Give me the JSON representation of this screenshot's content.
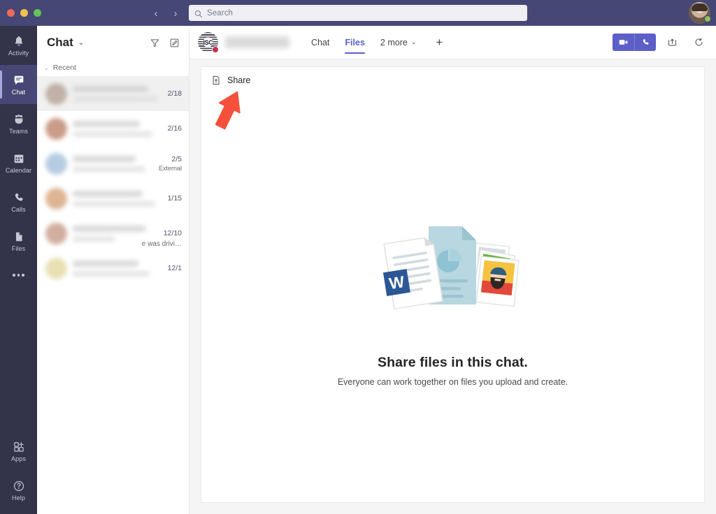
{
  "window": {
    "controls": [
      "close",
      "minimize",
      "maximize"
    ],
    "nav_back": "‹",
    "nav_forward": "›"
  },
  "search": {
    "placeholder": "Search",
    "value": "",
    "icon": "search-icon"
  },
  "user": {
    "presence": "available",
    "presence_color": "#92c353"
  },
  "rail": {
    "items": [
      {
        "label": "Activity",
        "icon": "bell-icon",
        "active": false
      },
      {
        "label": "Chat",
        "icon": "chat-bubble-icon",
        "active": true
      },
      {
        "label": "Teams",
        "icon": "teams-people-icon",
        "active": false
      },
      {
        "label": "Calendar",
        "icon": "calendar-icon",
        "active": false
      },
      {
        "label": "Calls",
        "icon": "phone-icon",
        "active": false
      },
      {
        "label": "Files",
        "icon": "file-icon",
        "active": false
      }
    ],
    "more_icon": "ellipsis-icon",
    "bottom_items": [
      {
        "label": "Apps",
        "icon": "apps-grid-icon"
      },
      {
        "label": "Help",
        "icon": "help-circle-icon"
      }
    ]
  },
  "chat_list": {
    "title": "Chat",
    "title_caret": "⌄",
    "filter_icon": "filter-funnel-icon",
    "compose_icon": "compose-new-chat-icon",
    "section": {
      "label": "Recent",
      "caret": "⌄"
    },
    "items": [
      {
        "date": "2/18",
        "tag": "",
        "snippet": "",
        "selected": true
      },
      {
        "date": "2/16",
        "tag": "",
        "snippet": "",
        "selected": false
      },
      {
        "date": "2/5",
        "tag": "External",
        "snippet": "",
        "selected": false
      },
      {
        "date": "1/15",
        "tag": "",
        "snippet": "",
        "selected": false
      },
      {
        "date": "12/10",
        "tag": "",
        "snippet": "e was drivi…",
        "selected": false
      },
      {
        "date": "12/1",
        "tag": "",
        "snippet": "",
        "selected": false
      }
    ]
  },
  "conversation": {
    "avatar_text": "ISC",
    "presence": "busy",
    "presence_color": "#c4314b",
    "tabs": [
      {
        "label": "Chat",
        "active": false
      },
      {
        "label": "Files",
        "active": true
      },
      {
        "label": "2 more",
        "active": false,
        "caret": "⌄"
      }
    ],
    "add_tab": "+",
    "actions": [
      {
        "name": "video-call",
        "icon": "video-camera-icon"
      },
      {
        "name": "audio-call",
        "icon": "phone-icon"
      },
      {
        "name": "open-in-new-window",
        "icon": "pop-out-icon"
      },
      {
        "name": "history",
        "icon": "refresh-history-icon"
      }
    ],
    "accent_color": "#5b5fc7"
  },
  "files": {
    "share_button": {
      "label": "Share",
      "icon": "upload-file-icon"
    },
    "empty_state": {
      "title": "Share files in this chat.",
      "subtitle": "Everyone can work together on files you upload and create.",
      "illustration": "documents-and-photos-illustration"
    }
  },
  "annotation": {
    "arrow": {
      "color": "#f4503c",
      "points_to": "share-button",
      "direction": "up-right"
    }
  }
}
